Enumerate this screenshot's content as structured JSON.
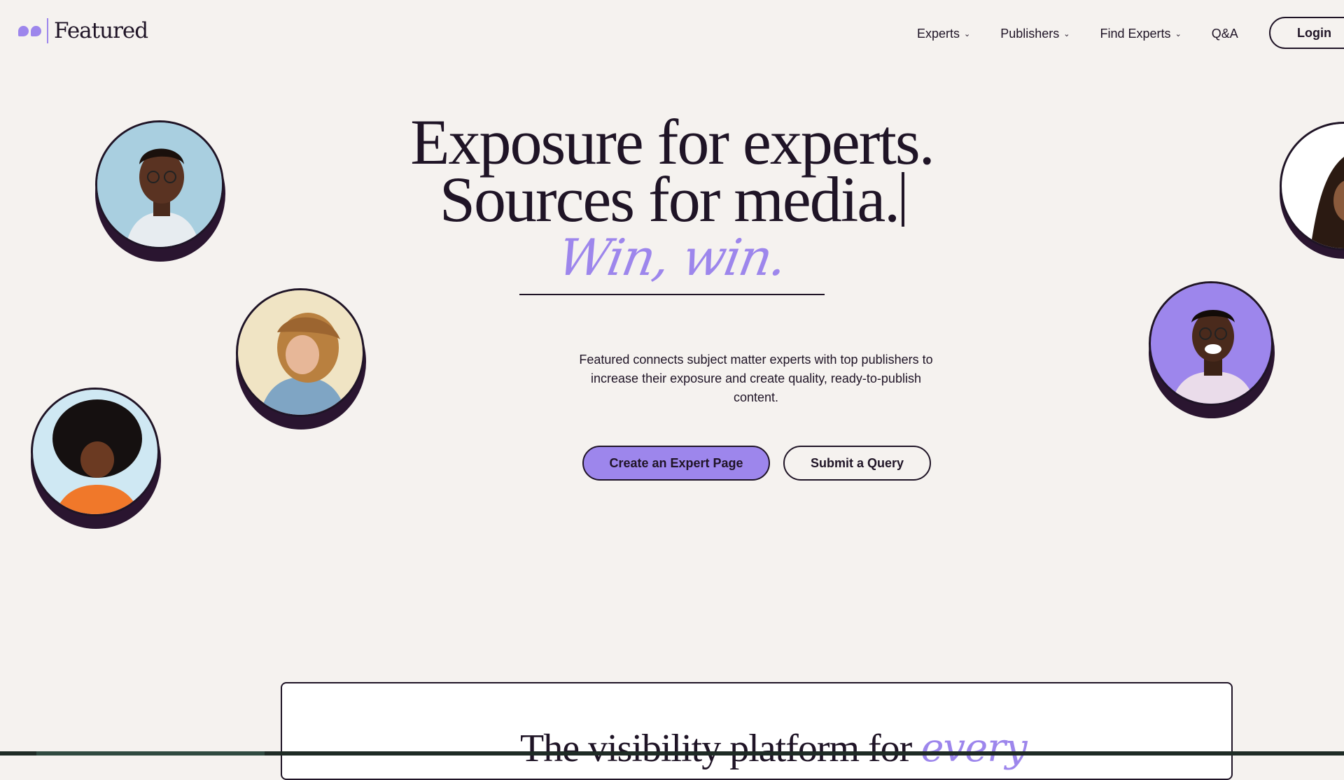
{
  "brand": {
    "name": "Featured",
    "accent_color": "#9d86ec",
    "dark_color": "#1f1426",
    "background": "#f5f2ef"
  },
  "nav": {
    "items": [
      {
        "label": "Experts",
        "dropdown": true
      },
      {
        "label": "Publishers",
        "dropdown": true
      },
      {
        "label": "Find Experts",
        "dropdown": true
      },
      {
        "label": "Q&A",
        "dropdown": false
      }
    ],
    "chevron": "⌄",
    "login_label": "Login"
  },
  "hero": {
    "headline_line1": "Exposure for experts.",
    "headline_line2": "Sources for media.",
    "tagline": "Win, win.",
    "description": "Featured connects subject matter experts with top publishers to increase their exposure and create quality, ready-to-publish content.",
    "primary_cta": "Create an Expert Page",
    "secondary_cta": "Submit a Query"
  },
  "avatars": [
    {
      "name": "expert-avatar-man-glasses",
      "bg": "#a9cfe0"
    },
    {
      "name": "expert-avatar-woman-denim",
      "bg": "#f0e4c4"
    },
    {
      "name": "expert-avatar-woman-afro",
      "bg": "#cfe8f3"
    },
    {
      "name": "expert-avatar-man-laughing",
      "bg": "#9d86ec"
    },
    {
      "name": "expert-avatar-woman-partial",
      "bg": "#ffffff"
    }
  ],
  "bottom_section": {
    "title": "The visibility platform for",
    "title_accent": "every"
  }
}
